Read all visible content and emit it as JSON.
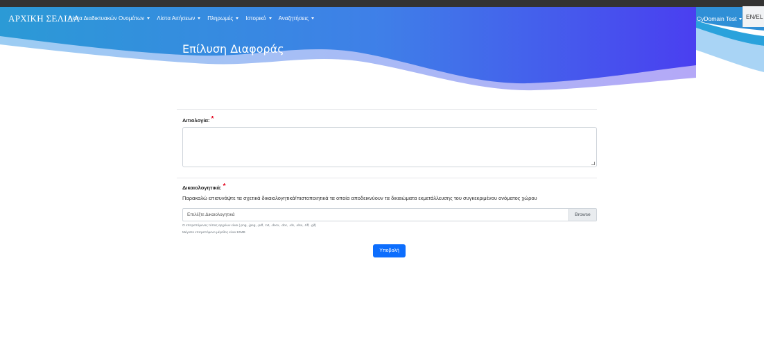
{
  "navbar": {
    "brand": "ΑΡΧΙΚΗ ΣΕΛΙΔΑ",
    "links": [
      {
        "label": "Λίστα Διαδικτυακών Ονομάτων"
      },
      {
        "label": "Λίστα Αιτήσεων"
      },
      {
        "label": "Πληρωμές"
      },
      {
        "label": "Ιστορικό"
      },
      {
        "label": "Αναζητήσεις"
      }
    ],
    "user": "CyDomain Test",
    "language": "EN/EL"
  },
  "hero": {
    "title": "Επίλυση Διαφοράς"
  },
  "form": {
    "reason_label": "Αιτιολογία:",
    "documents_label": "Δικαιολογητικά:",
    "required_mark": "*",
    "documents_help": "Παρακαλώ επισυνάψτε τα σχετικά δικαιολογητικά/πιστοποιητικά τα οποία αποδεικνύουν τα δικαιώματα εκμετάλλευσης του συγκεκριμένου ονόματος χώρου",
    "file_placeholder": "Επιλέξτε Δικαιολογητικά",
    "browse_label": "Browse",
    "allowed_types_note": "Ο επιτρεπόμενος τύπος αρχείων είναι (.png, .jpeg, .pdf, .txt, .docx, .doc, .xls, .xlsx, .tiff, .gif)",
    "max_size_note": "Μέγιστο επιτρεπόμενο μέγεθος είναι 10MB",
    "submit_label": "Υποβολή"
  },
  "colors": {
    "hero_dark": "#4a3ff0",
    "hero_mid": "#2aa2dc",
    "hero_light": "#a9d4f5",
    "required": "#e3001b",
    "submit": "#0d6efd"
  }
}
